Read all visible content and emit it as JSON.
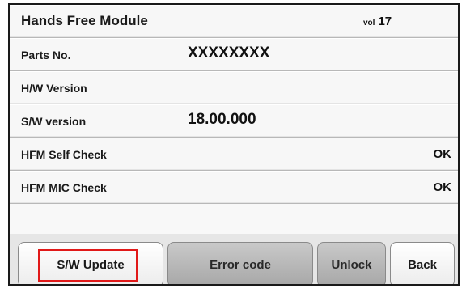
{
  "header": {
    "title": "Hands Free Module",
    "vol_label": "vol",
    "vol_number": "17"
  },
  "rows": [
    {
      "label": "Parts No.",
      "value": "XXXXXXXX"
    },
    {
      "label": "H/W Version",
      "value": ""
    },
    {
      "label": "S/W version",
      "value": "18.00.000"
    },
    {
      "label": "HFM Self Check",
      "value": "OK"
    },
    {
      "label": "HFM MIC Check",
      "value": "OK"
    }
  ],
  "buttons": {
    "sw_update": "S/W Update",
    "error_code": "Error code",
    "unlock": "Unlock",
    "back": "Back"
  },
  "colors": {
    "highlight": "#e11919"
  }
}
